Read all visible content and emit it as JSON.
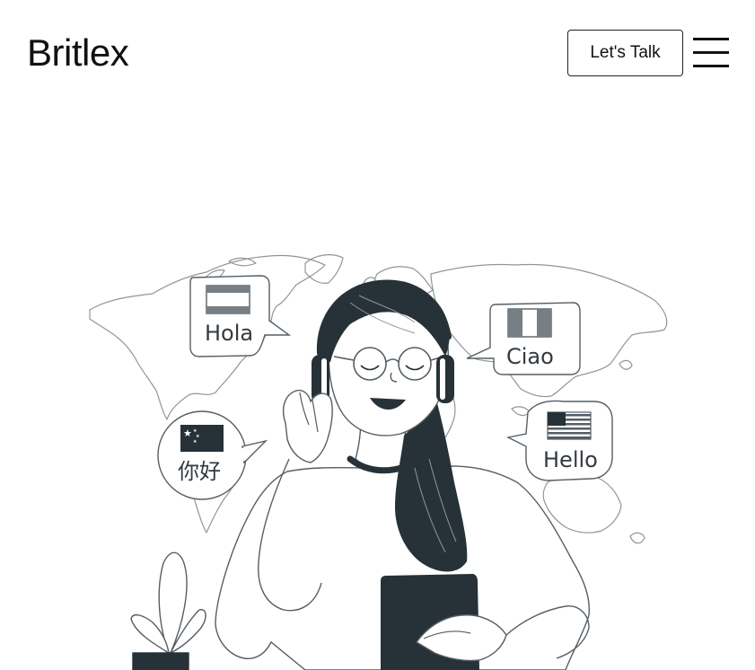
{
  "header": {
    "brand": "Britlex",
    "cta_label": "Let's Talk",
    "menu_icon": "hamburger-menu-icon"
  },
  "hero": {
    "illustration": "woman-headphones-world-map-illustration",
    "greetings": [
      {
        "text": "Hola",
        "flag": "spain-flag-icon"
      },
      {
        "text": "Ciao",
        "flag": "italy-flag-icon"
      },
      {
        "text": "你好",
        "flag": "china-flag-icon"
      },
      {
        "text": "Hello",
        "flag": "usa-flag-icon"
      }
    ]
  },
  "colors": {
    "ink": "#263238",
    "line": "#555e64",
    "map": "#9aa0a4",
    "background": "#ffffff"
  }
}
